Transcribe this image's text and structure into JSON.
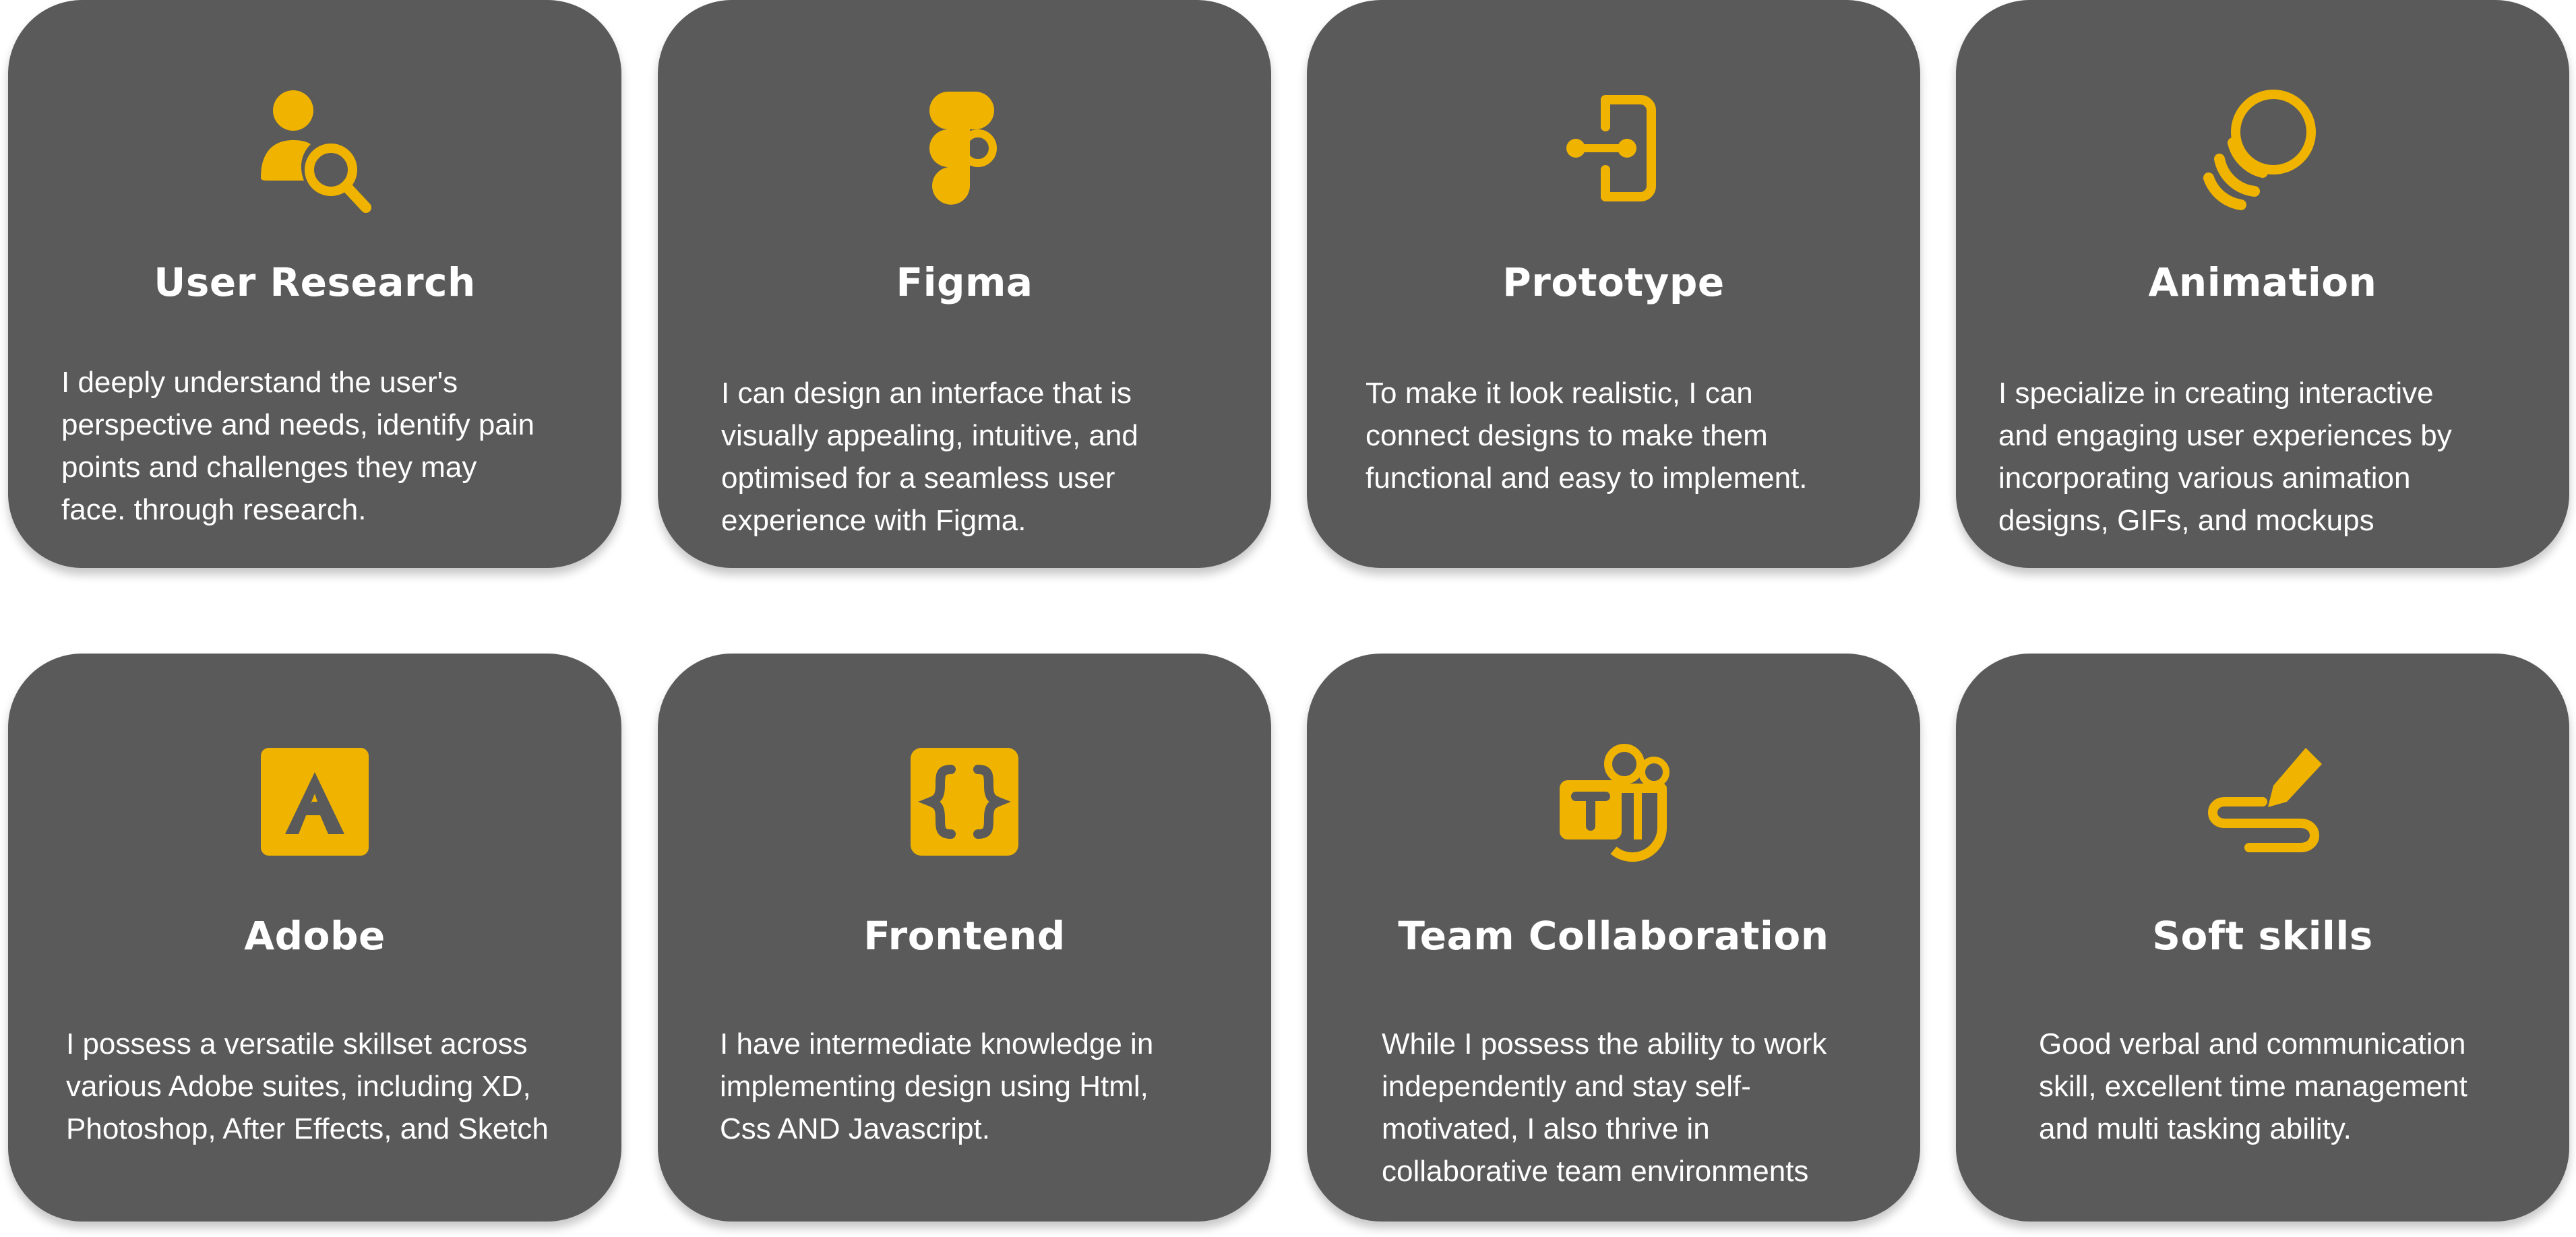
{
  "accent_color": "#f0b400",
  "card_color": "#5a5a5a",
  "cards": [
    {
      "icon": "user-research-icon",
      "title": "User Research",
      "description": "I deeply understand the user's\nperspective and needs, identify pain\npoints and challenges they may\nface. through research."
    },
    {
      "icon": "figma-icon",
      "title": "Figma",
      "description": "I can design an interface that is\nvisually appealing, intuitive, and\noptimised for a seamless user\nexperience with Figma."
    },
    {
      "icon": "prototype-icon",
      "title": "Prototype",
      "description": "To make it look realistic, I can\nconnect designs to make them\nfunctional and easy to implement."
    },
    {
      "icon": "animation-icon",
      "title": "Animation",
      "description": "I specialize in creating interactive\nand engaging user experiences by\nincorporating various animation\ndesigns, GIFs, and mockups"
    },
    {
      "icon": "adobe-icon",
      "title": "Adobe",
      "description": "I possess a versatile skillset across\nvarious Adobe suites, including XD,\nPhotoshop, After Effects, and Sketch"
    },
    {
      "icon": "code-braces-icon",
      "title": "Frontend",
      "description": "I have intermediate knowledge in\nimplementing design using Html,\nCss AND Javascript."
    },
    {
      "icon": "teams-icon",
      "title": "Team Collaboration",
      "description": "While I possess the ability to work\nindependently and stay self-\nmotivated, I also thrive in\ncollaborative team environments"
    },
    {
      "icon": "signature-pen-icon",
      "title": "Soft skills",
      "description": "Good verbal and communication\nskill, excellent time management\nand multi tasking ability."
    }
  ]
}
